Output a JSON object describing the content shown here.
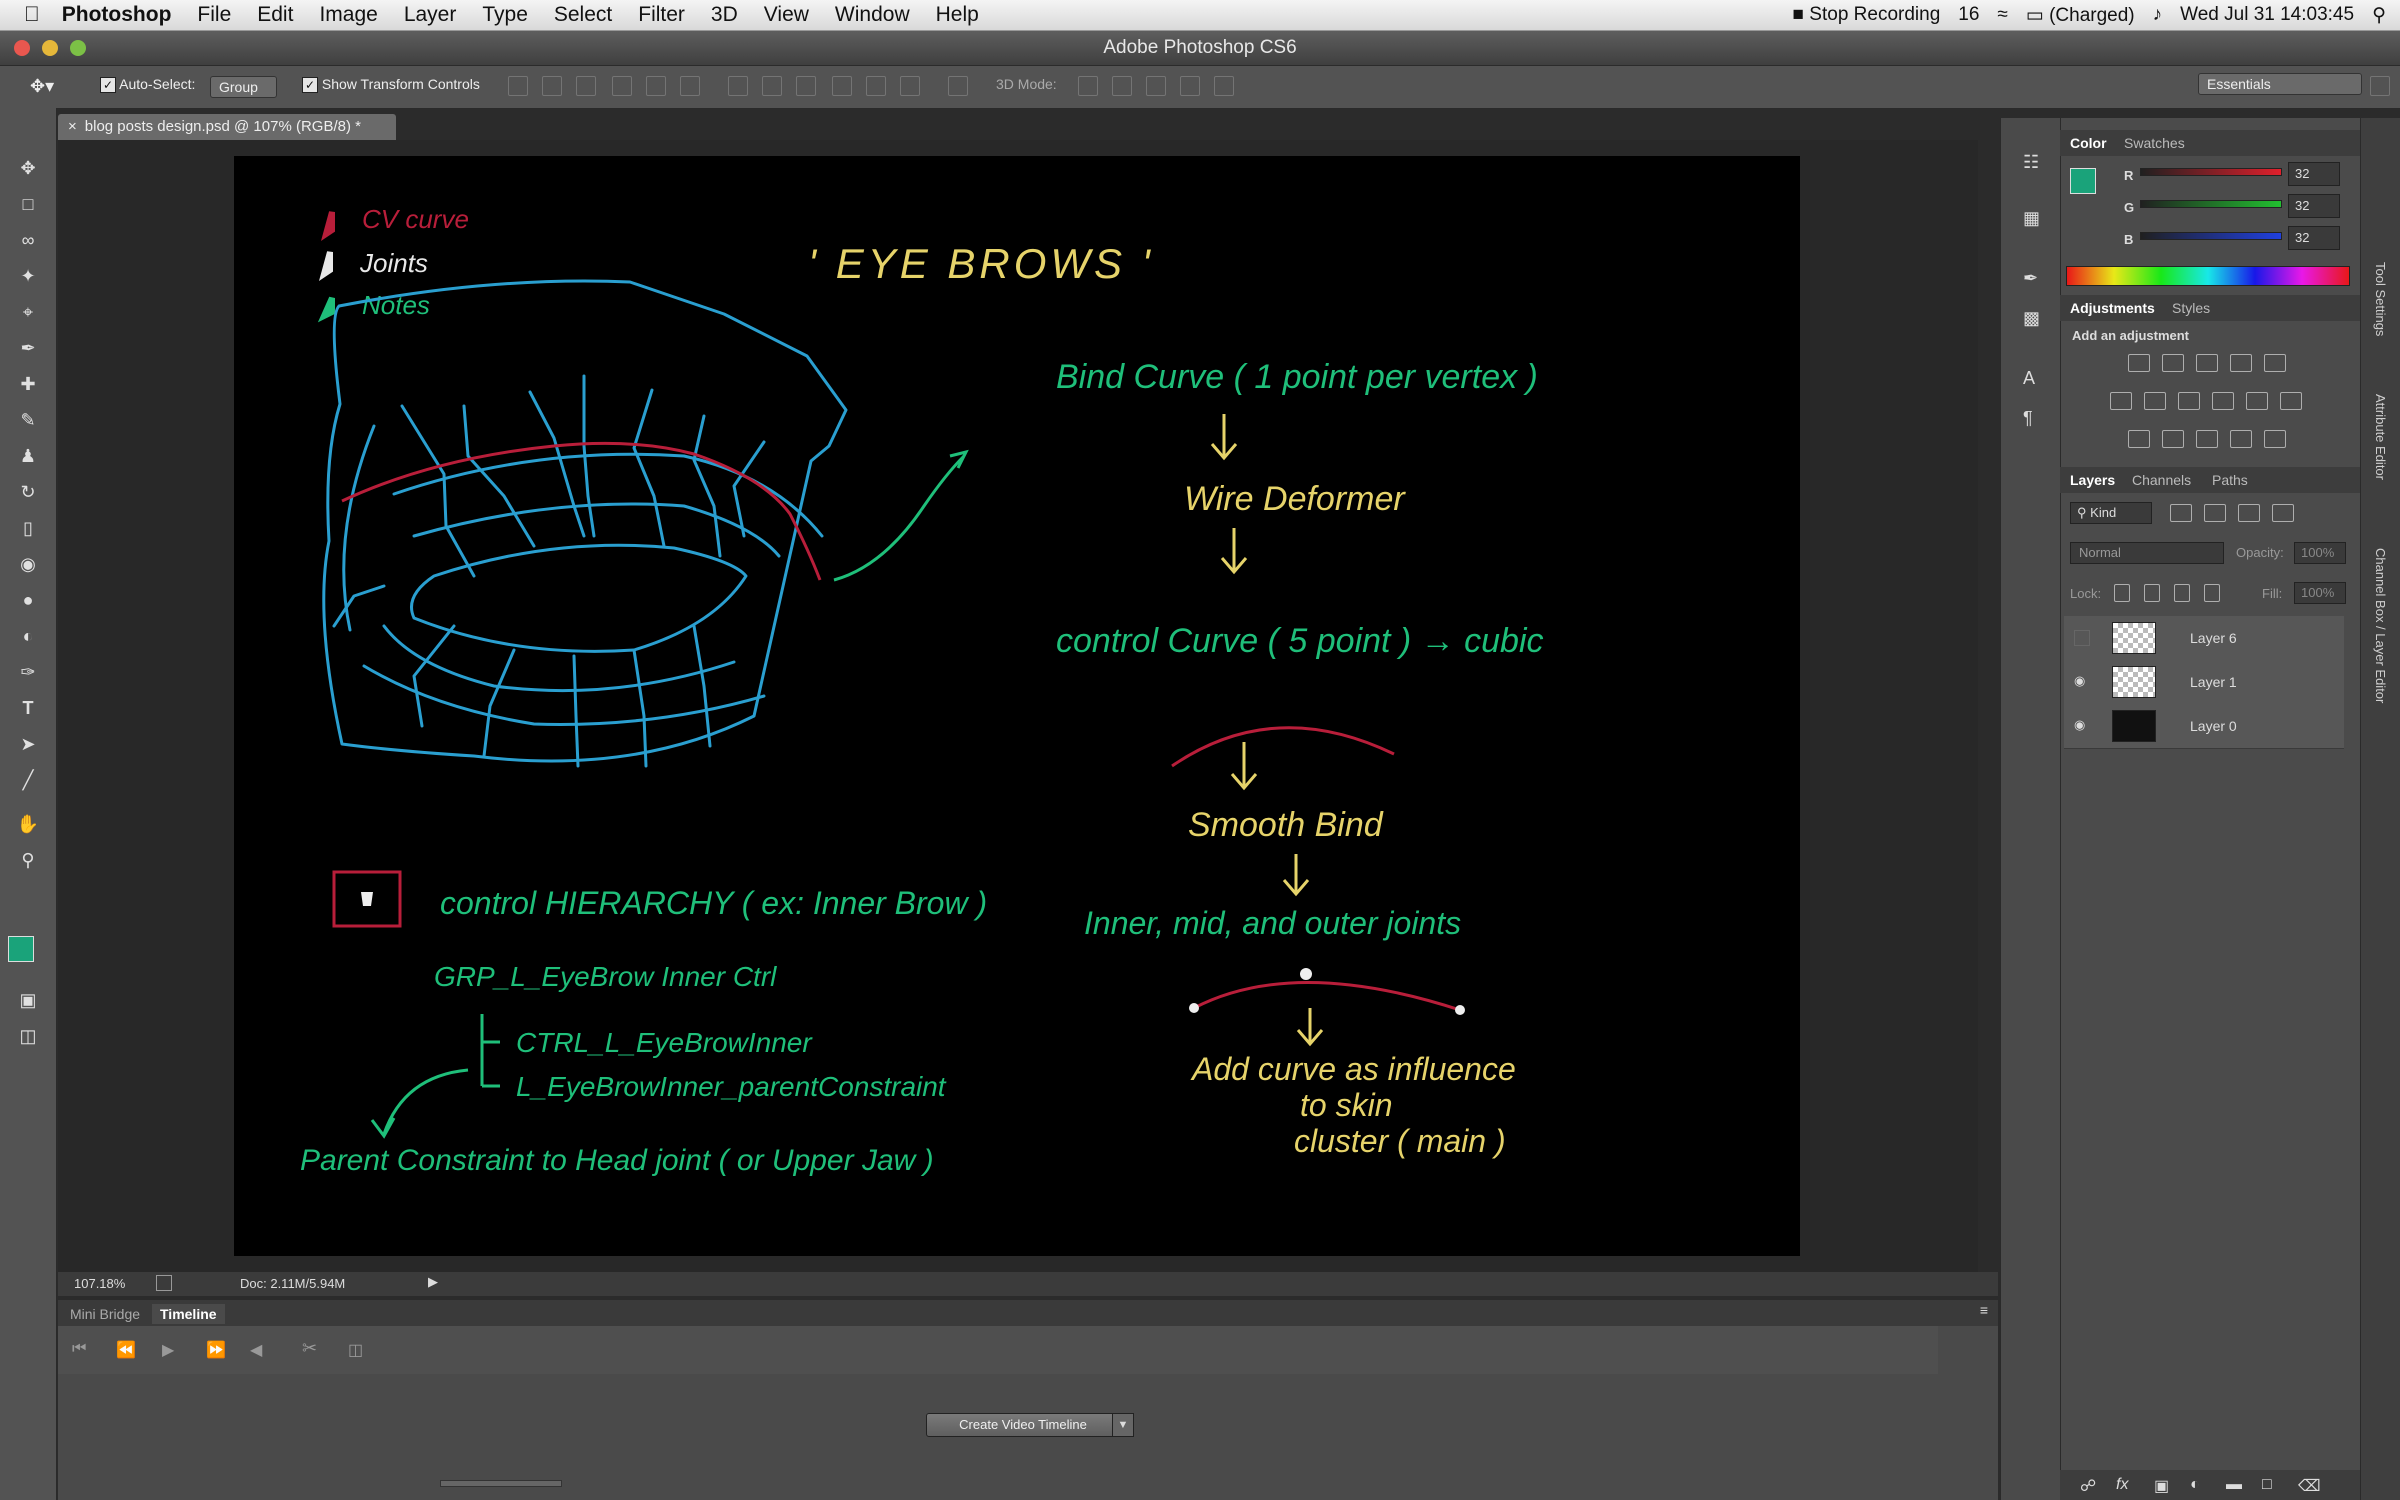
{
  "menubar": {
    "app": "Photoshop",
    "items": [
      "File",
      "Edit",
      "Image",
      "Layer",
      "Type",
      "Select",
      "Filter",
      "3D",
      "View",
      "Window",
      "Help"
    ],
    "recording": "Stop Recording",
    "status_num": "16",
    "battery": "(Charged)",
    "datetime": "Wed Jul 31  14:03:45"
  },
  "window": {
    "title": "Adobe Photoshop CS6"
  },
  "options": {
    "auto_select": "Auto-Select:",
    "auto_select_value": "Group",
    "transform": "Show Transform Controls",
    "mode3d": "3D Mode:",
    "workspace": "Essentials"
  },
  "document": {
    "tab": "blog posts design.psd @ 107% (RGB/8) *"
  },
  "drawing": {
    "title": "' EYE  BROWS '",
    "legend": [
      "CV curve",
      "Joints",
      "Notes"
    ],
    "flow": [
      "Bind Curve ( 1 point per vertex )",
      "Wire Deformer",
      "control Curve ( 5 point )  → cubic",
      "Smooth Bind",
      "Inner,  mid,  and  outer     joints",
      "Add curve as influence",
      "to skin",
      "cluster ( main )"
    ],
    "hierarchy_title": "control HIERARCHY  ( ex: Inner Brow )",
    "hierarchy": [
      "GRP_L_EyeBrow Inner Ctrl",
      "CTRL_L_EyeBrowInner",
      "L_EyeBrowInner_parentConstraint"
    ],
    "constraint_note": "Parent Constraint  to  Head  joint  ( or Upper Jaw )"
  },
  "status": {
    "zoom": "107.18%",
    "doc": "Doc: 2.11M/5.94M"
  },
  "timeline": {
    "tabs": [
      "Mini Bridge",
      "Timeline"
    ],
    "active_tab": "Timeline",
    "create_button": "Create Video Timeline"
  },
  "color_panel": {
    "tabs": [
      "Color",
      "Swatches"
    ],
    "r_label": "R",
    "g_label": "G",
    "b_label": "B",
    "r": "32",
    "g": "32",
    "b": "32",
    "foreground": "#1aa37a"
  },
  "adjustments_panel": {
    "tabs": [
      "Adjustments",
      "Styles"
    ],
    "heading": "Add an adjustment"
  },
  "layers_panel": {
    "tabs": [
      "Layers",
      "Channels",
      "Paths"
    ],
    "kind": "Kind",
    "blend_mode": "Normal",
    "opacity_label": "Opacity:",
    "opacity_value": "100%",
    "lock_label": "Lock:",
    "fill_label": "Fill:",
    "fill_value": "100%",
    "layers": [
      "Layer 6",
      "Layer 1",
      "Layer 0"
    ]
  },
  "side_labels": [
    "Tool Settings",
    "Attribute Editor",
    "Channel Box / Layer Editor"
  ],
  "colors": {
    "blue_ink": "#2a9fd0",
    "red_ink": "#b81e3a",
    "green_ink": "#1fbf7a",
    "yellow_ink": "#e6d36a"
  }
}
